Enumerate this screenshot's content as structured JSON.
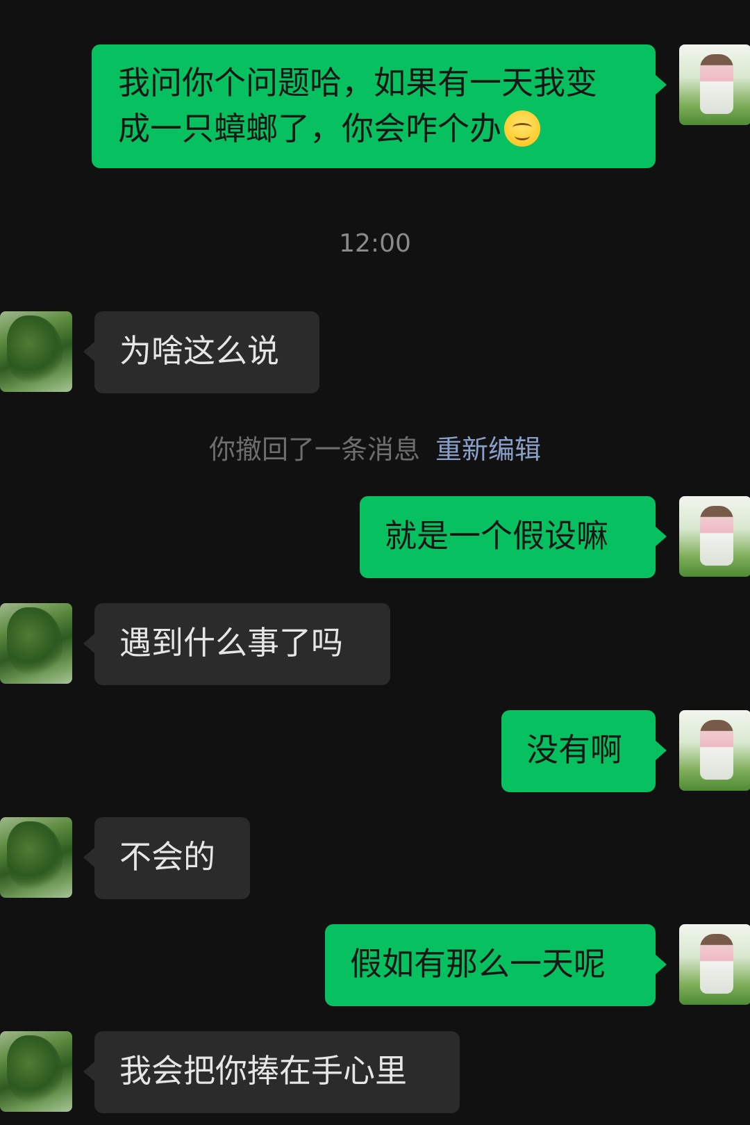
{
  "messages": [
    {
      "side": "self",
      "lines": [
        "我问你个问题哈，如果有一天我变",
        "成一只蟑螂了，你会咋个办"
      ],
      "emoji": "smiling-face-emoji"
    },
    {
      "side": "other",
      "text": "为啥这么说"
    },
    {
      "side": "self",
      "text": "就是一个假设嘛"
    },
    {
      "side": "other",
      "text": "遇到什么事了吗"
    },
    {
      "side": "self",
      "text": "没有啊"
    },
    {
      "side": "other",
      "text": "不会的"
    },
    {
      "side": "self",
      "text": "假如有那么一天呢"
    },
    {
      "side": "other",
      "text": "我会把你捧在手心里"
    }
  ],
  "timestamp": "12:00",
  "recall_notice": {
    "text": "你撤回了一条消息",
    "edit_label": "重新编辑"
  },
  "colors": {
    "background": "#111111",
    "self_bubble": "#07c160",
    "other_bubble": "#2b2b2b",
    "edit_link": "#8aa0c8"
  }
}
